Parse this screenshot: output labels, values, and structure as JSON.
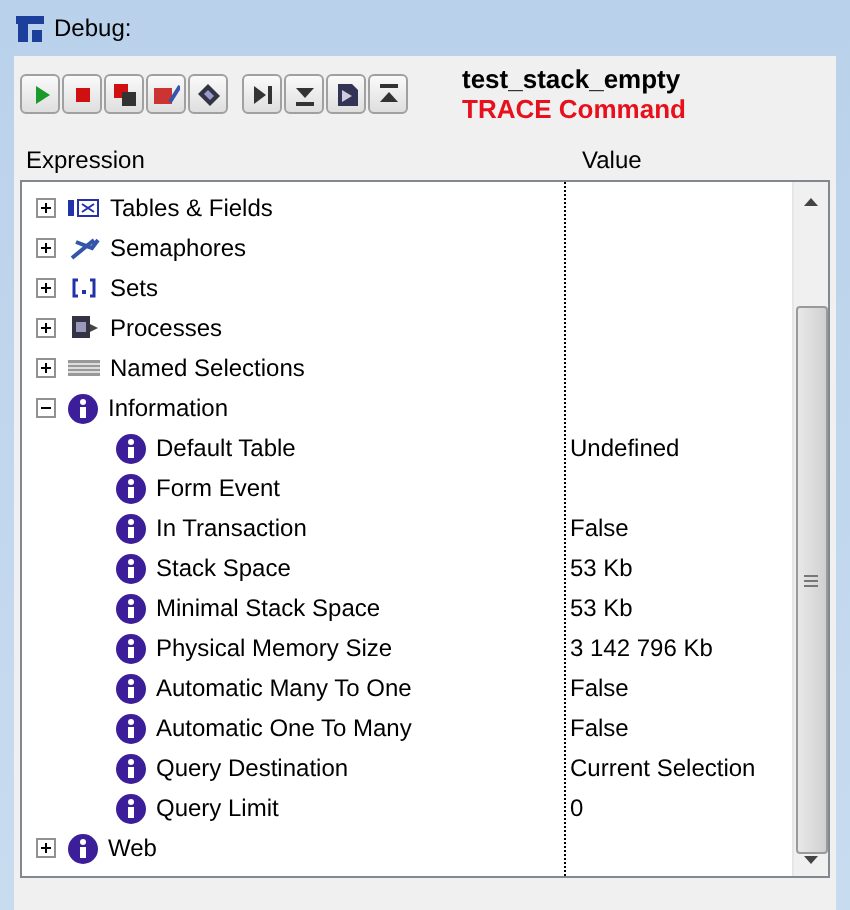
{
  "window": {
    "title": "Debug:"
  },
  "header": {
    "method": "test_stack_empty",
    "command": "TRACE Command"
  },
  "columns": [
    "Expression",
    "Value"
  ],
  "tree": [
    {
      "label": "Tables & Fields",
      "kind": "table",
      "expanded": false
    },
    {
      "label": "Semaphores",
      "kind": "semaphore",
      "expanded": false
    },
    {
      "label": "Sets",
      "kind": "set",
      "expanded": false
    },
    {
      "label": "Processes",
      "kind": "process",
      "expanded": false
    },
    {
      "label": "Named Selections",
      "kind": "selection",
      "expanded": false
    },
    {
      "label": "Information",
      "kind": "info",
      "expanded": true,
      "children": [
        {
          "label": "Default Table",
          "value": "Undefined"
        },
        {
          "label": "Form Event"
        },
        {
          "label": "In Transaction",
          "value": "False"
        },
        {
          "label": "Stack Space",
          "value": "53 Kb"
        },
        {
          "label": "Minimal Stack Space",
          "value": "53 Kb"
        },
        {
          "label": "Physical Memory Size",
          "value": "3 142 796 Kb"
        },
        {
          "label": "Automatic Many To One",
          "value": "False"
        },
        {
          "label": "Automatic One To Many",
          "value": "False"
        },
        {
          "label": "Query Destination",
          "value": "Current Selection"
        },
        {
          "label": "Query Limit",
          "value": "0"
        }
      ]
    },
    {
      "label": "Web",
      "kind": "info",
      "expanded": false
    }
  ]
}
